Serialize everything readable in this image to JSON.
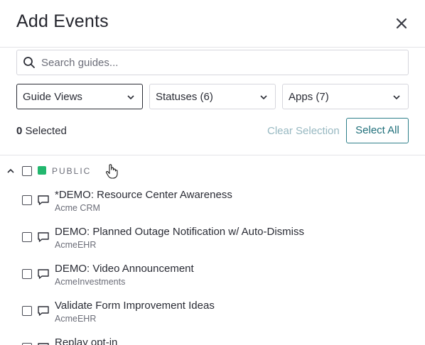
{
  "header": {
    "title": "Add Events"
  },
  "search": {
    "placeholder": "Search guides...",
    "value": ""
  },
  "filters": [
    {
      "label": "Guide Views"
    },
    {
      "label": "Statuses (6)"
    },
    {
      "label": "Apps (7)"
    }
  ],
  "selection": {
    "count": "0",
    "suffix": " Selected",
    "clear_label": "Clear Selection",
    "select_all_label": "Select All"
  },
  "group": {
    "label": "PUBLIC",
    "color": "#22b76e"
  },
  "items": [
    {
      "name": "*DEMO: Resource Center Awareness",
      "app": "Acme CRM"
    },
    {
      "name": "DEMO: Planned Outage Notification w/ Auto-Dismiss",
      "app": "AcmeEHR"
    },
    {
      "name": "DEMO: Video Announcement",
      "app": "AcmeInvestments"
    },
    {
      "name": "Validate Form Improvement Ideas",
      "app": "AcmeEHR"
    },
    {
      "name": "Replay opt-in",
      "app": ""
    }
  ],
  "icons": {
    "close": "close-icon",
    "search": "search-icon",
    "chevron": "chevron-down-icon",
    "caret": "chevron-up-icon",
    "guide": "speech-bubble-icon",
    "cursor": "hand-cursor-icon"
  },
  "colors": {
    "accent": "#1f6f7a",
    "clear_disabled": "#97b8c1",
    "public_dot": "#22b76e"
  }
}
